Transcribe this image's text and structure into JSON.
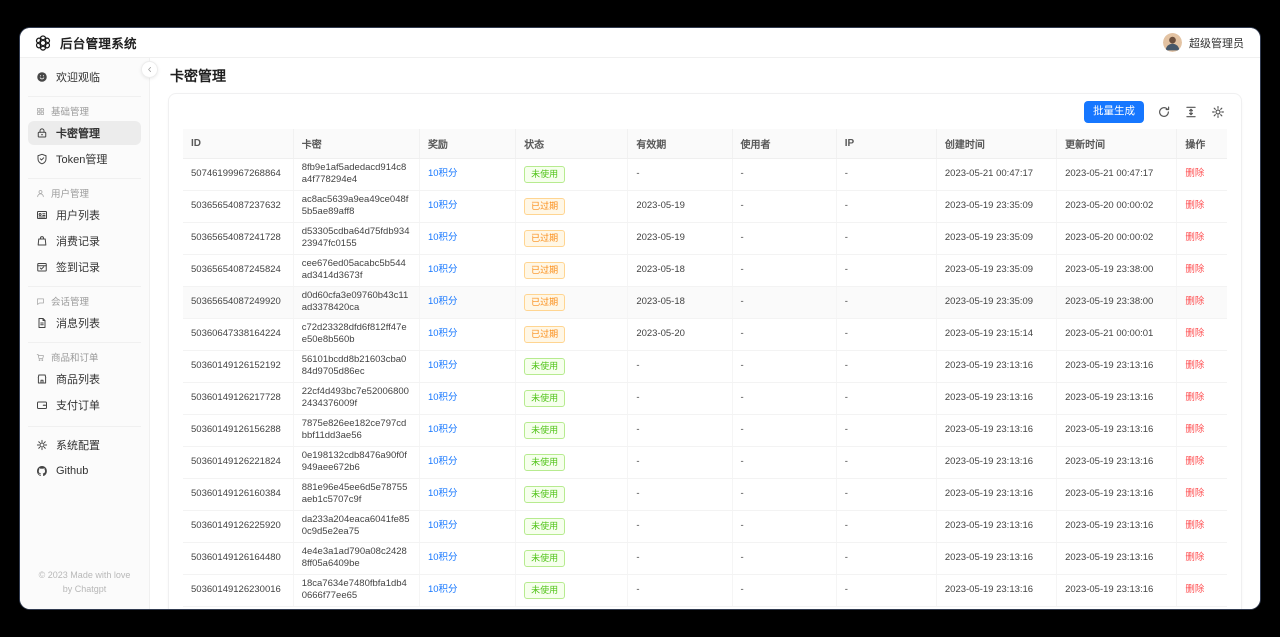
{
  "app": {
    "title": "后台管理系统",
    "logo_icon": "openai-logo-icon",
    "user": {
      "name": "超级管理员",
      "avatar_icon": "avatar"
    }
  },
  "sidebar": {
    "items": [
      {
        "type": "item",
        "icon": "smile-icon",
        "label": "欢迎观临"
      },
      {
        "type": "group",
        "icon": "apps-icon",
        "label": "基础管理"
      },
      {
        "type": "item",
        "icon": "lock-icon",
        "label": "卡密管理",
        "active": true
      },
      {
        "type": "item",
        "icon": "shield-icon",
        "label": "Token管理"
      },
      {
        "type": "group",
        "icon": "user-icon",
        "label": "用户管理"
      },
      {
        "type": "item",
        "icon": "idcard-icon",
        "label": "用户列表"
      },
      {
        "type": "item",
        "icon": "bag-icon",
        "label": "消费记录"
      },
      {
        "type": "item",
        "icon": "checkin-icon",
        "label": "签到记录"
      },
      {
        "type": "group",
        "icon": "chat-icon",
        "label": "会话管理"
      },
      {
        "type": "item",
        "icon": "document-icon",
        "label": "消息列表"
      },
      {
        "type": "group",
        "icon": "cart-icon",
        "label": "商品和订单"
      },
      {
        "type": "item",
        "icon": "shop-icon",
        "label": "商品列表"
      },
      {
        "type": "item",
        "icon": "wallet-icon",
        "label": "支付订单"
      },
      {
        "type": "divider"
      },
      {
        "type": "item",
        "icon": "gear-icon",
        "label": "系统配置"
      },
      {
        "type": "item",
        "icon": "github-icon",
        "label": "Github"
      }
    ],
    "footer_line1": "© 2023 Made with love",
    "footer_line2": "by Chatgpt"
  },
  "page": {
    "title": "卡密管理",
    "collapse_icon": "chevron-left-icon"
  },
  "toolbar": {
    "generate_label": "批量生成",
    "icons": [
      "reload-icon",
      "column-height-icon",
      "settings-icon"
    ]
  },
  "table": {
    "columns": [
      "ID",
      "卡密",
      "奖励",
      "状态",
      "有效期",
      "使用者",
      "IP",
      "创建时间",
      "更新时间",
      "操作"
    ],
    "rows": [
      {
        "id": "50746199967268864",
        "key": "8fb9e1af5adedacd914c8a4f778294e4",
        "reward": "10积分",
        "status": "未使用",
        "status_type": "unused",
        "expiry": "-",
        "user": "-",
        "ip": "-",
        "created": "2023-05-21 00:47:17",
        "updated": "2023-05-21 00:47:17",
        "action": "删除"
      },
      {
        "id": "50365654087237632",
        "key": "ac8ac5639a9ea49ce048f5b5ae89aff8",
        "reward": "10积分",
        "status": "已过期",
        "status_type": "expired",
        "expiry": "2023-05-19",
        "user": "-",
        "ip": "-",
        "created": "2023-05-19 23:35:09",
        "updated": "2023-05-20 00:00:02",
        "action": "删除"
      },
      {
        "id": "50365654087241728",
        "key": "d53305cdba64d75fdb93423947fc0155",
        "reward": "10积分",
        "status": "已过期",
        "status_type": "expired",
        "expiry": "2023-05-19",
        "user": "-",
        "ip": "-",
        "created": "2023-05-19 23:35:09",
        "updated": "2023-05-20 00:00:02",
        "action": "删除"
      },
      {
        "id": "50365654087245824",
        "key": "cee676ed05acabc5b544ad3414d3673f",
        "reward": "10积分",
        "status": "已过期",
        "status_type": "expired",
        "expiry": "2023-05-18",
        "user": "-",
        "ip": "-",
        "created": "2023-05-19 23:35:09",
        "updated": "2023-05-19 23:38:00",
        "action": "删除"
      },
      {
        "id": "50365654087249920",
        "key": "d0d60cfa3e09760b43c11ad3378420ca",
        "reward": "10积分",
        "status": "已过期",
        "status_type": "expired",
        "expiry": "2023-05-18",
        "user": "-",
        "ip": "-",
        "created": "2023-05-19 23:35:09",
        "updated": "2023-05-19 23:38:00",
        "action": "删除",
        "highlight": true
      },
      {
        "id": "50360647338164224",
        "key": "c72d23328dfd6f812ff47ee50e8b560b",
        "reward": "10积分",
        "status": "已过期",
        "status_type": "expired",
        "expiry": "2023-05-20",
        "user": "-",
        "ip": "-",
        "created": "2023-05-19 23:15:14",
        "updated": "2023-05-21 00:00:01",
        "action": "删除"
      },
      {
        "id": "50360149126152192",
        "key": "56101bcdd8b21603cba084d9705d86ec",
        "reward": "10积分",
        "status": "未使用",
        "status_type": "unused",
        "expiry": "-",
        "user": "-",
        "ip": "-",
        "created": "2023-05-19 23:13:16",
        "updated": "2023-05-19 23:13:16",
        "action": "删除"
      },
      {
        "id": "50360149126217728",
        "key": "22cf4d493bc7e520068002434376009f",
        "reward": "10积分",
        "status": "未使用",
        "status_type": "unused",
        "expiry": "-",
        "user": "-",
        "ip": "-",
        "created": "2023-05-19 23:13:16",
        "updated": "2023-05-19 23:13:16",
        "action": "删除"
      },
      {
        "id": "50360149126156288",
        "key": "7875e826ee182ce797cdbbf11dd3ae56",
        "reward": "10积分",
        "status": "未使用",
        "status_type": "unused",
        "expiry": "-",
        "user": "-",
        "ip": "-",
        "created": "2023-05-19 23:13:16",
        "updated": "2023-05-19 23:13:16",
        "action": "删除"
      },
      {
        "id": "50360149126221824",
        "key": "0e198132cdb8476a90f0f949aee672b6",
        "reward": "10积分",
        "status": "未使用",
        "status_type": "unused",
        "expiry": "-",
        "user": "-",
        "ip": "-",
        "created": "2023-05-19 23:13:16",
        "updated": "2023-05-19 23:13:16",
        "action": "删除"
      },
      {
        "id": "50360149126160384",
        "key": "881e96e45ee6d5e78755aeb1c5707c9f",
        "reward": "10积分",
        "status": "未使用",
        "status_type": "unused",
        "expiry": "-",
        "user": "-",
        "ip": "-",
        "created": "2023-05-19 23:13:16",
        "updated": "2023-05-19 23:13:16",
        "action": "删除"
      },
      {
        "id": "50360149126225920",
        "key": "da233a204eaca6041fe850c9d5e2ea75",
        "reward": "10积分",
        "status": "未使用",
        "status_type": "unused",
        "expiry": "-",
        "user": "-",
        "ip": "-",
        "created": "2023-05-19 23:13:16",
        "updated": "2023-05-19 23:13:16",
        "action": "删除"
      },
      {
        "id": "50360149126164480",
        "key": "4e4e3a1ad790a08c24288ff05a6409be",
        "reward": "10积分",
        "status": "未使用",
        "status_type": "unused",
        "expiry": "-",
        "user": "-",
        "ip": "-",
        "created": "2023-05-19 23:13:16",
        "updated": "2023-05-19 23:13:16",
        "action": "删除"
      },
      {
        "id": "50360149126230016",
        "key": "18ca7634e7480fbfa1db40666f77ee65",
        "reward": "10积分",
        "status": "未使用",
        "status_type": "unused",
        "expiry": "-",
        "user": "-",
        "ip": "-",
        "created": "2023-05-19 23:13:16",
        "updated": "2023-05-19 23:13:16",
        "action": "删除"
      }
    ]
  },
  "colors": {
    "accent": "#1677ff",
    "success": "#52c41a",
    "warning": "#fa8c16",
    "danger": "#ff4d4f"
  }
}
